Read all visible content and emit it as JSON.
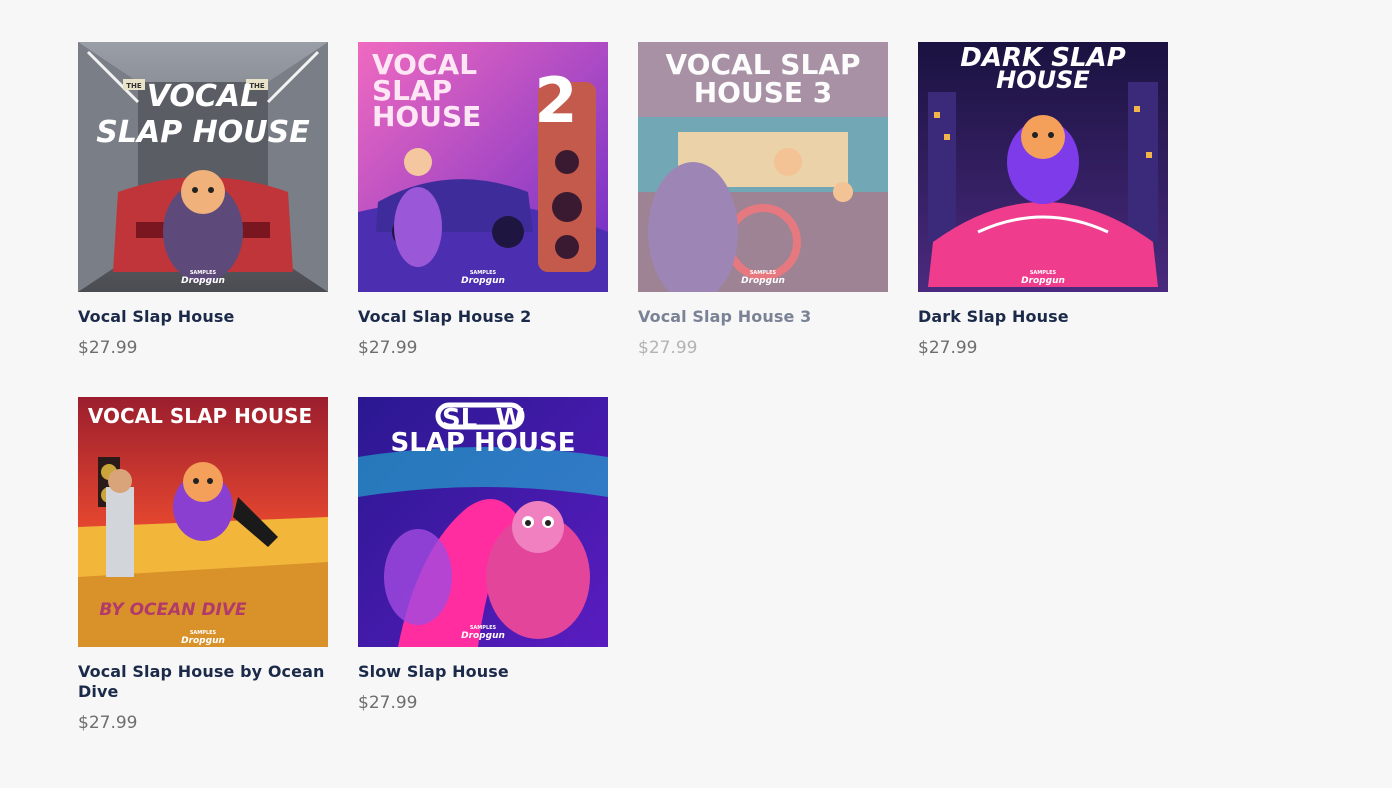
{
  "products": [
    {
      "title": "Vocal Slap House",
      "price": "$27.99",
      "cover_lines": [
        "VOCAL",
        "SLAP HOUSE"
      ],
      "cover_badges": [
        "THE",
        "THE"
      ],
      "brand_small": "SAMPLES",
      "brand": "Dropgun",
      "colors": {
        "bg": "#6b6f78",
        "accent": "#c0353a",
        "char": "#5e4a7a"
      }
    },
    {
      "title": "Vocal Slap House 2",
      "price": "$27.99",
      "cover_lines": [
        "VOCAL",
        "SLAP",
        "HOUSE"
      ],
      "cover_number": "2",
      "brand_small": "SAMPLES",
      "brand": "Dropgun",
      "colors": {
        "bg": "#d63ea8",
        "accent": "#3d2c9a",
        "char": "#9a57d8"
      }
    },
    {
      "title": "Vocal Slap House 3",
      "price": "$27.99",
      "cover_lines": [
        "VOCAL SLAP",
        "HOUSE 3"
      ],
      "brand_small": "SAMPLES",
      "brand": "Dropgun",
      "colors": {
        "bg": "#8a6a86",
        "accent": "#3f8a9c",
        "char": "#7b5c9e"
      }
    },
    {
      "title": "Dark Slap House",
      "price": "$27.99",
      "cover_lines": [
        "DARK SLAP",
        "HOUSE"
      ],
      "brand_small": "SAMPLES",
      "brand": "Dropgun",
      "colors": {
        "bg": "#2a1a5e",
        "accent": "#ef3c8c",
        "char": "#7d3bea"
      }
    },
    {
      "title": "Vocal Slap House by Ocean Dive",
      "price": "$27.99",
      "cover_lines": [
        "VOCAL SLAP HOUSE"
      ],
      "cover_tag": "BY OCEAN DIVE",
      "brand_small": "SAMPLES",
      "brand": "Dropgun",
      "colors": {
        "bg": "#e2452f",
        "accent": "#f2b63b",
        "char": "#8a3fd0"
      }
    },
    {
      "title": "Slow Slap House",
      "price": "$27.99",
      "cover_lines": [
        "SL  W",
        "SLAP HOUSE"
      ],
      "brand_small": "SAMPLES",
      "brand": "Dropgun",
      "colors": {
        "bg": "#3a1ca8",
        "accent": "#ff2da0",
        "char": "#e2459a"
      }
    }
  ]
}
